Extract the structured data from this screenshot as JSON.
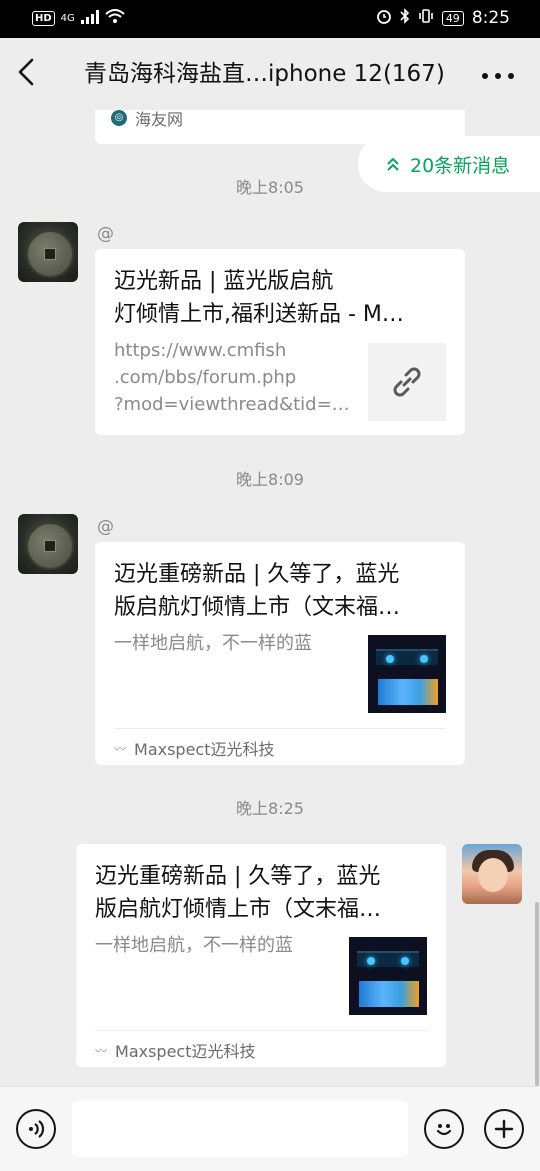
{
  "status_bar": {
    "hd": "HD",
    "network": "4G",
    "battery": "49",
    "time": "8:25"
  },
  "header": {
    "back_icon": "chevron-left-icon",
    "title": "青岛海科海盐直…iphone 12(167)",
    "more_icon": "more-icon"
  },
  "chat": {
    "top_card_source": "海友网",
    "new_messages": "20条新消息",
    "messages": [
      {
        "timestamp": "晚上8:05",
        "at": "@",
        "title_line1": "迈光新品 | 蓝光版启航",
        "title_line2": "灯倾情上市,福利送新品 - M…",
        "desc_line1": "https://www.cmfish",
        "desc_line2": ".com/bbs/forum.php",
        "desc_line3": "?mod=viewthread&tid=…",
        "thumb_icon": "link-icon"
      },
      {
        "timestamp": "晚上8:09",
        "at": "@",
        "title_line1": "迈光重磅新品 | 久等了，蓝光",
        "title_line2": "版启航灯倾情上市（文末福…",
        "desc": "一样地启航，不一样的蓝",
        "footer": "Maxspect迈光科技"
      },
      {
        "timestamp": "晚上8:25",
        "title_line1": "迈光重磅新品 | 久等了，蓝光",
        "title_line2": "版启航灯倾情上市（文末福…",
        "desc": "一样地启航，不一样的蓝",
        "footer": "Maxspect迈光科技"
      }
    ]
  },
  "input_bar": {
    "voice_icon": "voice-icon",
    "emoji_icon": "emoji-icon",
    "plus_icon": "plus-icon"
  },
  "colors": {
    "accent_green": "#07a55b",
    "chat_bg": "#ededed",
    "card_bg": "#ffffff"
  }
}
